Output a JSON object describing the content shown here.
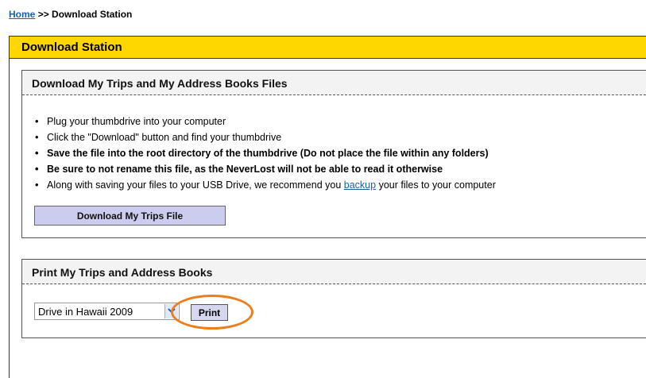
{
  "breadcrumb": {
    "home_label": "Home",
    "separator": ">>",
    "current": "Download Station"
  },
  "station": {
    "title": "Download Station",
    "header_color": "#ffd700"
  },
  "download_section": {
    "title": "Download My Trips and My Address Books Files",
    "bullets": [
      {
        "text": "Plug your thumbdrive into your computer",
        "bold": false
      },
      {
        "text": "Click the \"Download\" button and find your thumbdrive",
        "bold": false
      },
      {
        "text": "Save the file into the root directory of the thumbdrive (Do not place the file within any folders)",
        "bold": true
      },
      {
        "text": "Be sure to not rename this file, as the NeverLost will not be able to read it otherwise",
        "bold": true
      }
    ],
    "last_bullet": {
      "before": "Along with saving your files to your USB Drive, we recommend you ",
      "link": "backup",
      "after": " your files to your computer"
    },
    "button_label": "Download My Trips File"
  },
  "print_section": {
    "title": "Print My Trips and Address Books",
    "select_value": "Drive in Hawaii 2009",
    "print_label": "Print",
    "highlight_color": "#ef7d1a"
  }
}
